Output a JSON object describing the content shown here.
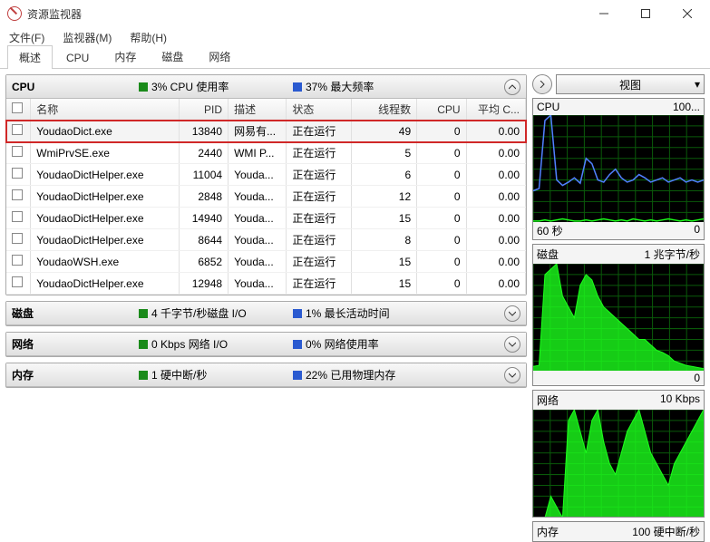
{
  "window": {
    "title": "资源监视器"
  },
  "menu": {
    "file": "文件(F)",
    "monitor": "监视器(M)",
    "help": "帮助(H)"
  },
  "tabs": [
    "概述",
    "CPU",
    "内存",
    "磁盘",
    "网络"
  ],
  "active_tab": 0,
  "view_button": "视图",
  "sections": {
    "cpu": {
      "title": "CPU",
      "stat1": "3% CPU 使用率",
      "stat2": "37% 最大频率",
      "expanded": true
    },
    "disk": {
      "title": "磁盘",
      "stat1": "4 千字节/秒磁盘 I/O",
      "stat2": "1% 最长活动时间",
      "expanded": false
    },
    "net": {
      "title": "网络",
      "stat1": "0 Kbps 网络 I/O",
      "stat2": "0% 网络使用率",
      "expanded": false
    },
    "mem": {
      "title": "内存",
      "stat1": "1 硬中断/秒",
      "stat2": "22% 已用物理内存",
      "expanded": false
    }
  },
  "cpu_table": {
    "headers": {
      "name": "名称",
      "pid": "PID",
      "desc": "描述",
      "status": "状态",
      "threads": "线程数",
      "cpu": "CPU",
      "avg": "平均 C..."
    },
    "rows": [
      {
        "name": "YoudaoDict.exe",
        "pid": 13840,
        "desc": "网易有...",
        "status": "正在运行",
        "threads": 49,
        "cpu": 0,
        "avg": "0.00",
        "hl": true,
        "sel": true
      },
      {
        "name": "WmiPrvSE.exe",
        "pid": 2440,
        "desc": "WMI P...",
        "status": "正在运行",
        "threads": 5,
        "cpu": 0,
        "avg": "0.00"
      },
      {
        "name": "YoudaoDictHelper.exe",
        "pid": 11004,
        "desc": "Youda...",
        "status": "正在运行",
        "threads": 6,
        "cpu": 0,
        "avg": "0.00"
      },
      {
        "name": "YoudaoDictHelper.exe",
        "pid": 2848,
        "desc": "Youda...",
        "status": "正在运行",
        "threads": 12,
        "cpu": 0,
        "avg": "0.00"
      },
      {
        "name": "YoudaoDictHelper.exe",
        "pid": 14940,
        "desc": "Youda...",
        "status": "正在运行",
        "threads": 15,
        "cpu": 0,
        "avg": "0.00"
      },
      {
        "name": "YoudaoDictHelper.exe",
        "pid": 8644,
        "desc": "Youda...",
        "status": "正在运行",
        "threads": 8,
        "cpu": 0,
        "avg": "0.00"
      },
      {
        "name": "YoudaoWSH.exe",
        "pid": 6852,
        "desc": "Youda...",
        "status": "正在运行",
        "threads": 15,
        "cpu": 0,
        "avg": "0.00"
      },
      {
        "name": "YoudaoDictHelper.exe",
        "pid": 12948,
        "desc": "Youda...",
        "status": "正在运行",
        "threads": 15,
        "cpu": 0,
        "avg": "0.00"
      }
    ]
  },
  "charts": {
    "cpu": {
      "title": "CPU",
      "right": "100...",
      "ftr_l": "60 秒",
      "ftr_r": "0"
    },
    "disk": {
      "title": "磁盘",
      "right": "1 兆字节/秒",
      "ftr_l": "",
      "ftr_r": "0"
    },
    "net": {
      "title": "网络",
      "right": "10 Kbps",
      "ftr_l": "",
      "ftr_r": ""
    },
    "mem": {
      "title": "内存",
      "right": "100 硬中断/秒",
      "ftr_l": "",
      "ftr_r": ""
    }
  },
  "chart_data": [
    {
      "type": "line",
      "title": "CPU",
      "ylim": [
        0,
        100
      ],
      "xlabel": "60 秒",
      "series": [
        {
          "name": "CPU 使用率",
          "color": "#1cff1c",
          "values": [
            2,
            2,
            3,
            2,
            3,
            4,
            3,
            2,
            2,
            3,
            2,
            3,
            4,
            3,
            2,
            3,
            2,
            4,
            3,
            2,
            3,
            2,
            3,
            4,
            3,
            2,
            3,
            2,
            3,
            4
          ]
        },
        {
          "name": "最大频率",
          "color": "#5080ff",
          "values": [
            30,
            32,
            95,
            100,
            40,
            35,
            38,
            42,
            37,
            60,
            55,
            40,
            38,
            45,
            50,
            42,
            38,
            40,
            45,
            42,
            38,
            40,
            42,
            38,
            40,
            42,
            38,
            40,
            38,
            40
          ]
        }
      ]
    },
    {
      "type": "area",
      "title": "磁盘",
      "ylim": [
        0,
        1
      ],
      "ylabel": "兆字节/秒",
      "series": [
        {
          "name": "磁盘 I/O",
          "color": "#1cff1c",
          "values": [
            0.05,
            0.06,
            0.9,
            0.95,
            1.0,
            0.7,
            0.6,
            0.5,
            0.8,
            0.9,
            0.85,
            0.7,
            0.6,
            0.55,
            0.5,
            0.45,
            0.4,
            0.35,
            0.3,
            0.3,
            0.25,
            0.2,
            0.18,
            0.15,
            0.1,
            0.08,
            0.06,
            0.05,
            0.04,
            0.03
          ]
        }
      ]
    },
    {
      "type": "area",
      "title": "网络",
      "ylim": [
        0,
        10
      ],
      "ylabel": "Kbps",
      "series": [
        {
          "name": "网络 I/O",
          "color": "#1cff1c",
          "values": [
            0,
            0,
            0,
            2,
            1,
            0,
            9,
            10,
            8,
            6,
            9,
            10,
            7,
            5,
            4,
            6,
            8,
            9,
            10,
            8,
            6,
            5,
            4,
            3,
            5,
            6,
            7,
            8,
            9,
            10
          ]
        }
      ]
    }
  ]
}
